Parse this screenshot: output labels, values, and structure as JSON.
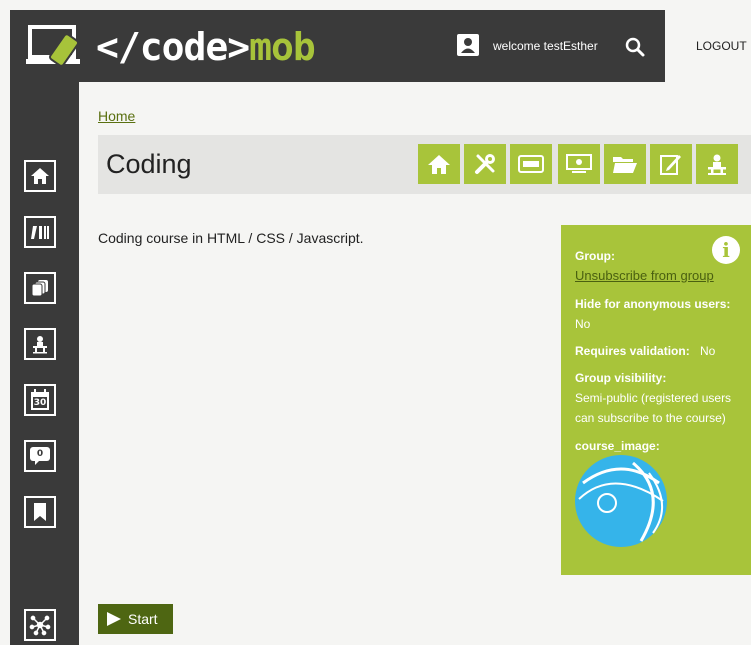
{
  "header": {
    "logo_prefix": "</code>",
    "logo_accent": "mob",
    "welcome": "welcome testEsther",
    "logout_label": "LOGOUT"
  },
  "sidebar": {
    "items": [
      {
        "icon": "home-icon"
      },
      {
        "icon": "library-icon"
      },
      {
        "icon": "copies-icon"
      },
      {
        "icon": "teacher-icon"
      },
      {
        "icon": "calendar-icon",
        "text": "30"
      },
      {
        "icon": "chat-icon",
        "count": "0"
      },
      {
        "icon": "bookmark-icon"
      },
      {
        "icon": "network-icon"
      }
    ]
  },
  "breadcrumb": {
    "home": "Home"
  },
  "course": {
    "title": "Coding",
    "description": "Coding course in HTML / CSS / Javascript."
  },
  "toolbar": {
    "buttons": [
      "home-icon",
      "tools-icon",
      "keyboard-icon",
      "screen-icon",
      "folder-icon",
      "edit-icon",
      "teacher-icon"
    ]
  },
  "info": {
    "group_label": "Group:",
    "unsubscribe": "Unsubscribe from group",
    "hide_label": "Hide for anonymous users:",
    "hide_value": "No",
    "validation_label": "Requires validation:",
    "validation_value": "No",
    "visibility_label": "Group visibility:",
    "visibility_line1": "Semi-public (registered users",
    "visibility_line2": "can subscribe to the course)",
    "image_label": "course_image:"
  },
  "start_label": "Start",
  "colors": {
    "accent": "#a8c43a",
    "dark": "#3a3a3a",
    "start": "#4e6612"
  }
}
